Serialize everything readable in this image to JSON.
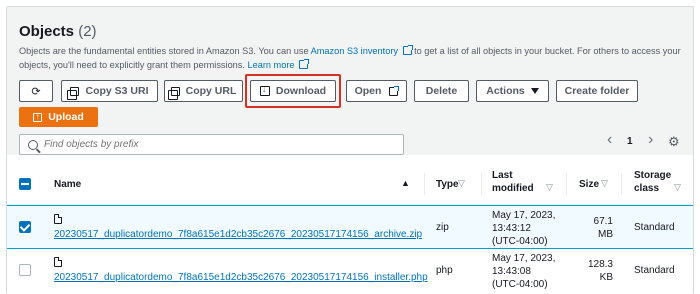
{
  "header": {
    "title": "Objects",
    "count": "(2)",
    "description_pre": "Objects are the fundamental entities stored in Amazon S3. You can use ",
    "inventory_link": "Amazon S3 inventory",
    "description_mid": " to get a list of all objects in your bucket. For others to access your objects, you'll need to explicitly grant them permissions. ",
    "learn_more": "Learn more"
  },
  "toolbar": {
    "refresh_icon": "refresh-icon",
    "copy_s3_uri": "Copy S3 URI",
    "copy_url": "Copy URL",
    "download": "Download",
    "open": "Open",
    "delete": "Delete",
    "actions": "Actions",
    "create_folder": "Create folder",
    "upload": "Upload"
  },
  "search": {
    "placeholder": "Find objects by prefix"
  },
  "pagination": {
    "prev": "‹",
    "page": "1",
    "next": "›",
    "settings_icon": "gear-icon"
  },
  "table": {
    "columns": {
      "name": "Name",
      "type": "Type",
      "last_modified_1": "Last",
      "last_modified_2": "modified",
      "size": "Size",
      "storage_1": "Storage",
      "storage_2": "class"
    },
    "rows": [
      {
        "selected": true,
        "name": "20230517_duplicatordemo_7f8a615e1d2cb35c2676_20230517174156_archive.zip",
        "type": "zip",
        "modified_1": "May 17, 2023,",
        "modified_2": "13:43:12",
        "modified_3": "(UTC-04:00)",
        "size_1": "67.1",
        "size_2": "MB",
        "storage": "Standard"
      },
      {
        "selected": false,
        "name": "20230517_duplicatordemo_7f8a615e1d2cb35c2676_20230517174156_installer.php",
        "type": "php",
        "modified_1": "May 17, 2023,",
        "modified_2": "13:43:08",
        "modified_3": "(UTC-04:00)",
        "size_1": "128.3",
        "size_2": "KB",
        "storage": "Standard"
      }
    ]
  },
  "colors": {
    "accent": "#0073bb",
    "primary_button": "#ec7211",
    "highlight": "#d93025"
  }
}
